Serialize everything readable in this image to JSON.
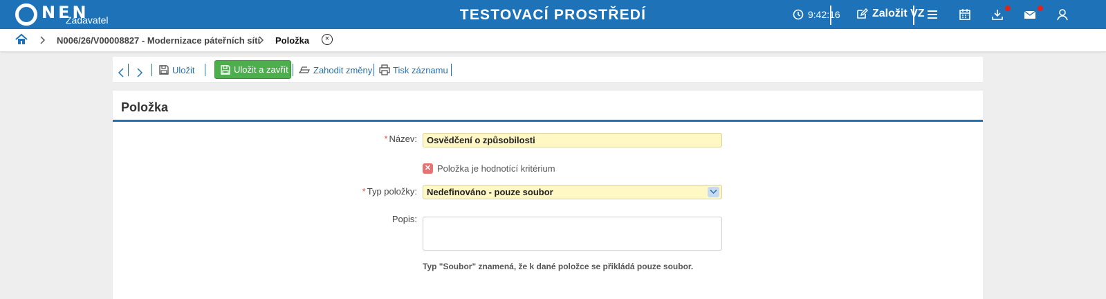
{
  "app": {
    "logo_text": "NEN",
    "logo_sub": "Zadavatel",
    "env_title": "TESTOVACÍ PROSTŘEDÍ",
    "clock": "9:42:16",
    "create_label": "Založit VZ"
  },
  "breadcrumb": {
    "parent": "N006/26/V00008827 - Modernizace páteřních sítí",
    "current": "Položka",
    "close_glyph": "×"
  },
  "toolbar": {
    "save": "Uložit",
    "save_close": "Uložit a zavřít",
    "discard": "Zahodit změny",
    "print": "Tisk záznamu"
  },
  "form": {
    "title": "Položka",
    "name_label": "Název:",
    "name_value": "Osvědčení o způsobilosti",
    "criterion_label": "Položka je hodnotící kritérium",
    "criterion_glyph": "✕",
    "type_label": "Typ položky:",
    "type_value": "Nedefinováno - pouze soubor",
    "desc_label": "Popis:",
    "required_mark": "*",
    "note": "Typ \"Soubor\" znamená, že k dané položce se přikládá pouze soubor."
  },
  "colors": {
    "brand": "#1e72b7",
    "green": "#4cae4c",
    "field_bg": "#fff7c4",
    "alert": "#e2231a"
  },
  "icons": [
    "clock-icon",
    "edit-icon",
    "menu-icon",
    "calendar-icon",
    "download-icon",
    "mail-icon",
    "user-icon",
    "home-icon",
    "chevron-right-icon",
    "save-icon",
    "discard-icon",
    "print-icon",
    "close-icon",
    "chevron-down-icon"
  ]
}
